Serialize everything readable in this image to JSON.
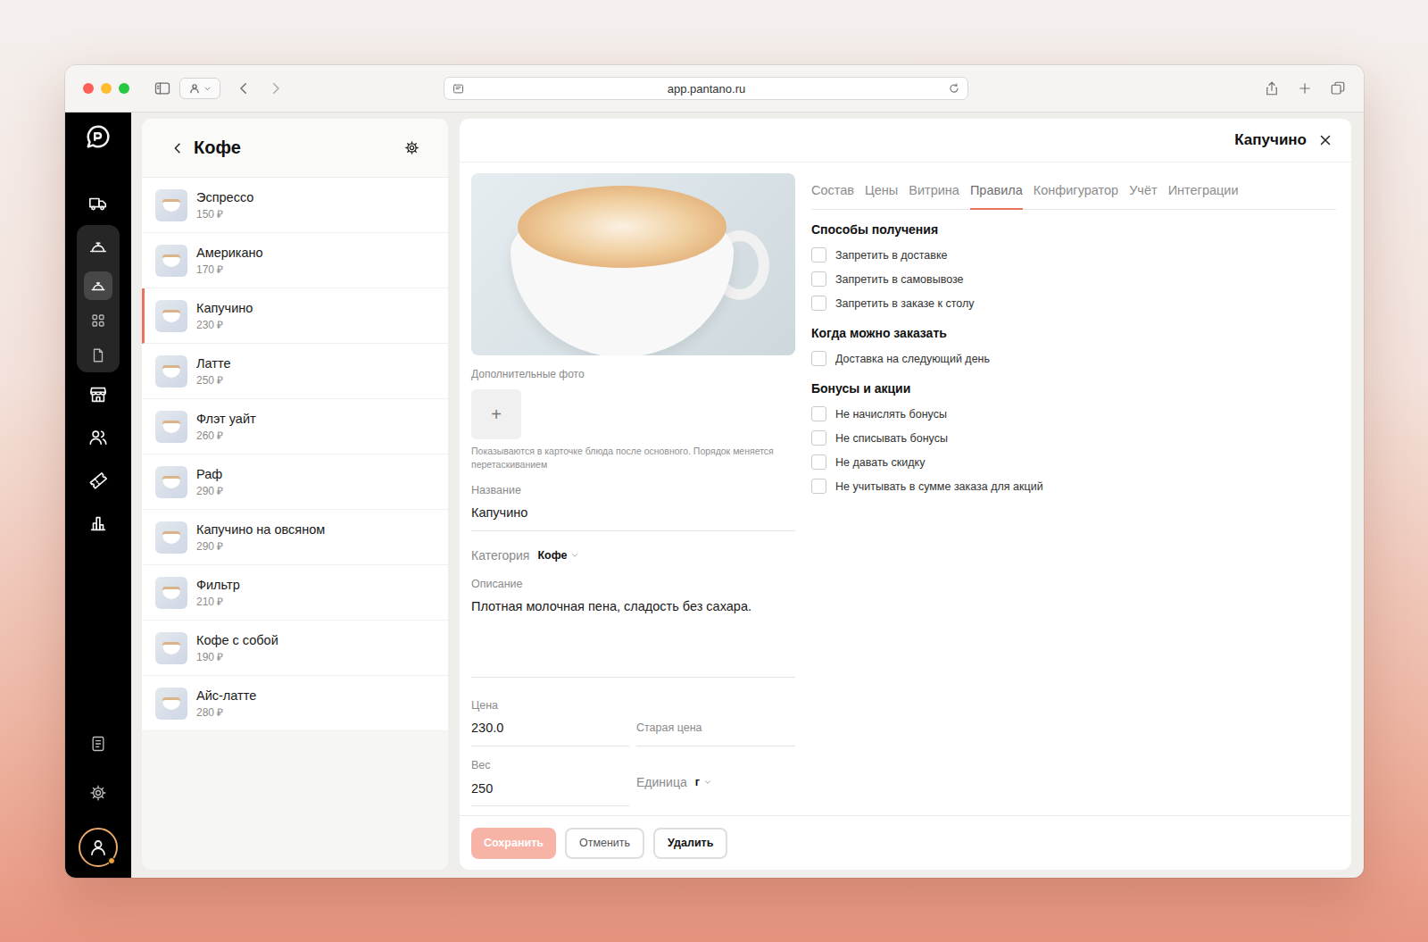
{
  "browser": {
    "url": "app.pantano.ru"
  },
  "nav": {
    "items": [
      {
        "selected": false
      },
      {
        "selected": false,
        "expanded": true,
        "children": [
          {
            "selected": true
          },
          {
            "selected": false
          },
          {
            "selected": false
          }
        ]
      },
      {
        "selected": false
      },
      {
        "selected": false
      },
      {
        "selected": false
      },
      {
        "selected": false
      }
    ],
    "bottom_items": [
      {
        "selected": false
      },
      {
        "selected": false
      }
    ],
    "user": {
      "has_notification": true
    }
  },
  "list": {
    "title": "Кофе",
    "items": [
      {
        "name": "Эспрессо",
        "price": "150 ₽",
        "selected": false
      },
      {
        "name": "Американо",
        "price": "170 ₽",
        "selected": false
      },
      {
        "name": "Капучино",
        "price": "230 ₽",
        "selected": true
      },
      {
        "name": "Латте",
        "price": "250 ₽",
        "selected": false
      },
      {
        "name": "Флэт уайт",
        "price": "260 ₽",
        "selected": false
      },
      {
        "name": "Раф",
        "price": "290 ₽",
        "selected": false
      },
      {
        "name": "Капучино на овсяном",
        "price": "290 ₽",
        "selected": false
      },
      {
        "name": "Фильтр",
        "price": "210 ₽",
        "selected": false
      },
      {
        "name": "Кофе с собой",
        "price": "190 ₽",
        "selected": false
      },
      {
        "name": "Айс-латте",
        "price": "280 ₽",
        "selected": false
      }
    ]
  },
  "detail": {
    "title": "Капучино",
    "photos": {
      "extra_label": "Дополнительные фото",
      "add": "+",
      "hint": "Показываются в карточке блюда после основного. Порядок меняется перетаскиванием"
    },
    "fields": {
      "name": {
        "label": "Название",
        "value": "Капучино"
      },
      "category": {
        "label": "Категория",
        "value": "Кофе"
      },
      "description": {
        "label": "Описание",
        "value": "Плотная молочная пена, сладость без сахара."
      },
      "price": {
        "label": "Цена",
        "value": "230.0"
      },
      "old_price": {
        "placeholder": "Старая цена"
      },
      "weight": {
        "label": "Вес",
        "value": "250"
      },
      "unit": {
        "label": "Единица",
        "value": "г"
      }
    },
    "tabs": [
      {
        "label": "Состав",
        "selected": false
      },
      {
        "label": "Цены",
        "selected": false
      },
      {
        "label": "Витрина",
        "selected": false
      },
      {
        "label": "Правила",
        "selected": true
      },
      {
        "label": "Конфигуратор",
        "selected": false
      },
      {
        "label": "Учёт",
        "selected": false
      },
      {
        "label": "Интеграции",
        "selected": false
      }
    ],
    "rules": [
      {
        "title": "Способы получения",
        "options": [
          {
            "label": "Запретить в доставке",
            "checked": false
          },
          {
            "label": "Запретить в самовывозе",
            "checked": false
          },
          {
            "label": "Запретить в заказе к столу",
            "checked": false
          }
        ]
      },
      {
        "title": "Когда можно заказать",
        "options": [
          {
            "label": "Доставка на следующий день",
            "checked": false
          }
        ]
      },
      {
        "title": "Бонусы и акции",
        "options": [
          {
            "label": "Не начислять бонусы",
            "checked": false
          },
          {
            "label": "Не списывать бонусы",
            "checked": false
          },
          {
            "label": "Не давать скидку",
            "checked": false
          },
          {
            "label": "Не учитывать в сумме заказа для акций",
            "checked": false
          }
        ]
      }
    ],
    "buttons": [
      {
        "label": "Сохранить",
        "kind": "primary",
        "disabled": true
      },
      {
        "label": "Отменить",
        "kind": "secondary",
        "disabled": false
      },
      {
        "label": "Удалить",
        "kind": "strong",
        "disabled": false
      }
    ]
  }
}
